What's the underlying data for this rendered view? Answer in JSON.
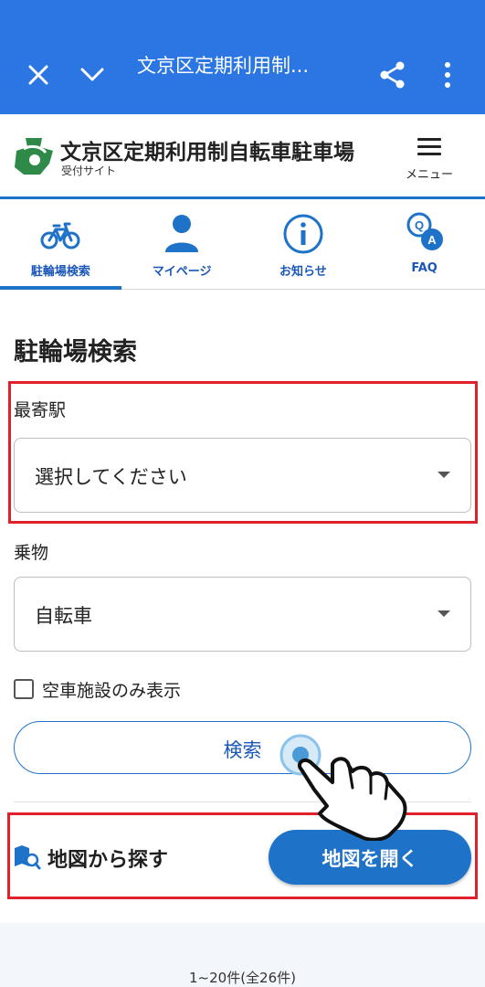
{
  "browser": {
    "title": "文京区定期利用制...",
    "icons": {
      "close": "close-icon",
      "collapse": "chevron-down-icon",
      "share": "share-icon",
      "more": "more-vert-icon"
    }
  },
  "site": {
    "title": "文京区定期利用制自転車駐車場",
    "subtitle": "受付サイト",
    "menu_label": "メニュー",
    "brand_color": "#1e73c9"
  },
  "tabs": [
    {
      "label": "駐輪場検索",
      "icon": "bicycle-icon",
      "active": true
    },
    {
      "label": "マイページ",
      "icon": "person-icon",
      "active": false
    },
    {
      "label": "お知らせ",
      "icon": "info-icon",
      "active": false
    },
    {
      "label": "FAQ",
      "icon": "qa-bubble-icon",
      "active": false
    }
  ],
  "search": {
    "heading": "駐輪場検索",
    "station_label": "最寄駅",
    "station_value": "選択してください",
    "vehicle_label": "乗物",
    "vehicle_value": "自転車",
    "vacancy_label": "空車施設のみ表示",
    "vacancy_checked": false,
    "search_button": "検索"
  },
  "map": {
    "label": "地図から探す",
    "button": "地図を開く"
  },
  "results": {
    "count_text": "1~20件(全26件)"
  },
  "annotation": {
    "highlight_color": "#e0202a"
  }
}
